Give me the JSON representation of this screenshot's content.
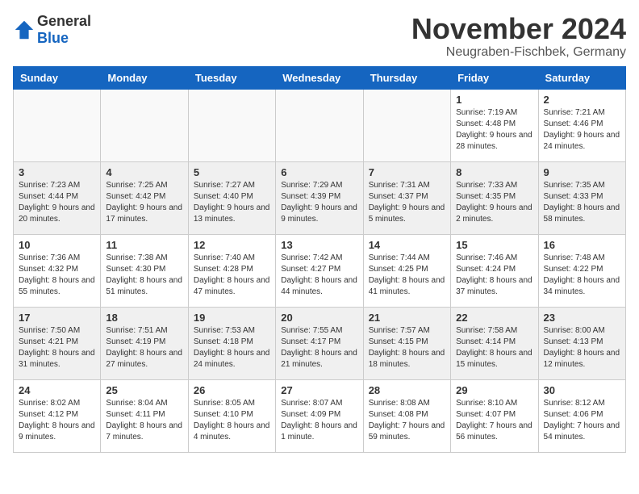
{
  "header": {
    "logo_general": "General",
    "logo_blue": "Blue",
    "month_title": "November 2024",
    "location": "Neugraben-Fischbek, Germany"
  },
  "days_of_week": [
    "Sunday",
    "Monday",
    "Tuesday",
    "Wednesday",
    "Thursday",
    "Friday",
    "Saturday"
  ],
  "weeks": [
    [
      {
        "day": "",
        "info": ""
      },
      {
        "day": "",
        "info": ""
      },
      {
        "day": "",
        "info": ""
      },
      {
        "day": "",
        "info": ""
      },
      {
        "day": "",
        "info": ""
      },
      {
        "day": "1",
        "info": "Sunrise: 7:19 AM\nSunset: 4:48 PM\nDaylight: 9 hours and 28 minutes."
      },
      {
        "day": "2",
        "info": "Sunrise: 7:21 AM\nSunset: 4:46 PM\nDaylight: 9 hours and 24 minutes."
      }
    ],
    [
      {
        "day": "3",
        "info": "Sunrise: 7:23 AM\nSunset: 4:44 PM\nDaylight: 9 hours and 20 minutes."
      },
      {
        "day": "4",
        "info": "Sunrise: 7:25 AM\nSunset: 4:42 PM\nDaylight: 9 hours and 17 minutes."
      },
      {
        "day": "5",
        "info": "Sunrise: 7:27 AM\nSunset: 4:40 PM\nDaylight: 9 hours and 13 minutes."
      },
      {
        "day": "6",
        "info": "Sunrise: 7:29 AM\nSunset: 4:39 PM\nDaylight: 9 hours and 9 minutes."
      },
      {
        "day": "7",
        "info": "Sunrise: 7:31 AM\nSunset: 4:37 PM\nDaylight: 9 hours and 5 minutes."
      },
      {
        "day": "8",
        "info": "Sunrise: 7:33 AM\nSunset: 4:35 PM\nDaylight: 9 hours and 2 minutes."
      },
      {
        "day": "9",
        "info": "Sunrise: 7:35 AM\nSunset: 4:33 PM\nDaylight: 8 hours and 58 minutes."
      }
    ],
    [
      {
        "day": "10",
        "info": "Sunrise: 7:36 AM\nSunset: 4:32 PM\nDaylight: 8 hours and 55 minutes."
      },
      {
        "day": "11",
        "info": "Sunrise: 7:38 AM\nSunset: 4:30 PM\nDaylight: 8 hours and 51 minutes."
      },
      {
        "day": "12",
        "info": "Sunrise: 7:40 AM\nSunset: 4:28 PM\nDaylight: 8 hours and 47 minutes."
      },
      {
        "day": "13",
        "info": "Sunrise: 7:42 AM\nSunset: 4:27 PM\nDaylight: 8 hours and 44 minutes."
      },
      {
        "day": "14",
        "info": "Sunrise: 7:44 AM\nSunset: 4:25 PM\nDaylight: 8 hours and 41 minutes."
      },
      {
        "day": "15",
        "info": "Sunrise: 7:46 AM\nSunset: 4:24 PM\nDaylight: 8 hours and 37 minutes."
      },
      {
        "day": "16",
        "info": "Sunrise: 7:48 AM\nSunset: 4:22 PM\nDaylight: 8 hours and 34 minutes."
      }
    ],
    [
      {
        "day": "17",
        "info": "Sunrise: 7:50 AM\nSunset: 4:21 PM\nDaylight: 8 hours and 31 minutes."
      },
      {
        "day": "18",
        "info": "Sunrise: 7:51 AM\nSunset: 4:19 PM\nDaylight: 8 hours and 27 minutes."
      },
      {
        "day": "19",
        "info": "Sunrise: 7:53 AM\nSunset: 4:18 PM\nDaylight: 8 hours and 24 minutes."
      },
      {
        "day": "20",
        "info": "Sunrise: 7:55 AM\nSunset: 4:17 PM\nDaylight: 8 hours and 21 minutes."
      },
      {
        "day": "21",
        "info": "Sunrise: 7:57 AM\nSunset: 4:15 PM\nDaylight: 8 hours and 18 minutes."
      },
      {
        "day": "22",
        "info": "Sunrise: 7:58 AM\nSunset: 4:14 PM\nDaylight: 8 hours and 15 minutes."
      },
      {
        "day": "23",
        "info": "Sunrise: 8:00 AM\nSunset: 4:13 PM\nDaylight: 8 hours and 12 minutes."
      }
    ],
    [
      {
        "day": "24",
        "info": "Sunrise: 8:02 AM\nSunset: 4:12 PM\nDaylight: 8 hours and 9 minutes."
      },
      {
        "day": "25",
        "info": "Sunrise: 8:04 AM\nSunset: 4:11 PM\nDaylight: 8 hours and 7 minutes."
      },
      {
        "day": "26",
        "info": "Sunrise: 8:05 AM\nSunset: 4:10 PM\nDaylight: 8 hours and 4 minutes."
      },
      {
        "day": "27",
        "info": "Sunrise: 8:07 AM\nSunset: 4:09 PM\nDaylight: 8 hours and 1 minute."
      },
      {
        "day": "28",
        "info": "Sunrise: 8:08 AM\nSunset: 4:08 PM\nDaylight: 7 hours and 59 minutes."
      },
      {
        "day": "29",
        "info": "Sunrise: 8:10 AM\nSunset: 4:07 PM\nDaylight: 7 hours and 56 minutes."
      },
      {
        "day": "30",
        "info": "Sunrise: 8:12 AM\nSunset: 4:06 PM\nDaylight: 7 hours and 54 minutes."
      }
    ]
  ]
}
